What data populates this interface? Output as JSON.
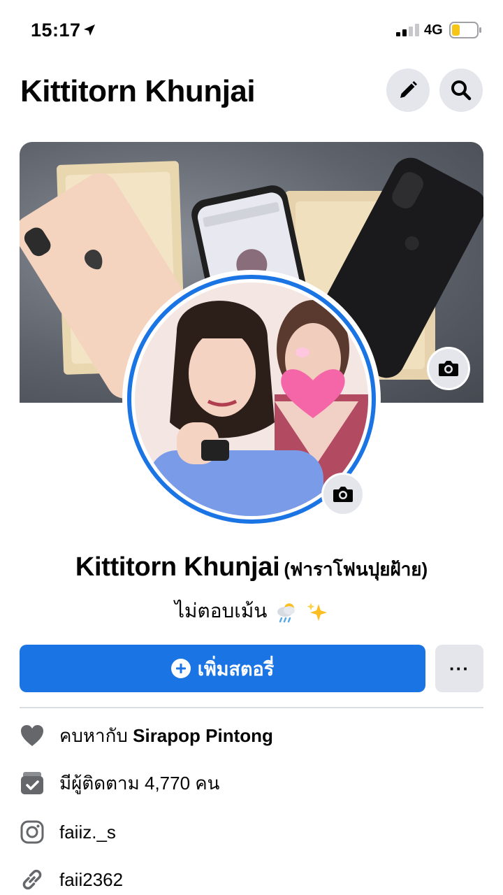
{
  "status_bar": {
    "time": "15:17",
    "network": "4G",
    "icons": [
      "location-arrow-icon",
      "signal-icon",
      "battery-icon"
    ]
  },
  "header": {
    "title": "Kittitorn Khunjai",
    "edit_icon": "pencil-icon",
    "search_icon": "search-icon"
  },
  "cover": {
    "camera_icon": "camera-icon"
  },
  "profile": {
    "camera_icon": "camera-icon",
    "name": "Kittitorn Khunjai",
    "alt_name": "(ฟาราโฟนปุยฝ้าย)",
    "bio": "ไม่ตอบเม้น",
    "bio_emojis": [
      "cloud-rain-icon",
      "sparkles-icon"
    ]
  },
  "actions": {
    "add_story_label": "เพิ่มสตอรี่",
    "more_label": "···"
  },
  "info": {
    "relationship_prefix": "คบหากับ",
    "relationship_partner": "Sirapop Pintong",
    "followers": "มีผู้ติดตาม 4,770 คน",
    "instagram": "faiiz._s",
    "link": "faii2362"
  },
  "colors": {
    "accent": "#1b74e4",
    "button_gray": "#e4e6eb",
    "text": "#050505",
    "icon_gray": "#65676b",
    "divider": "#dadde1"
  }
}
